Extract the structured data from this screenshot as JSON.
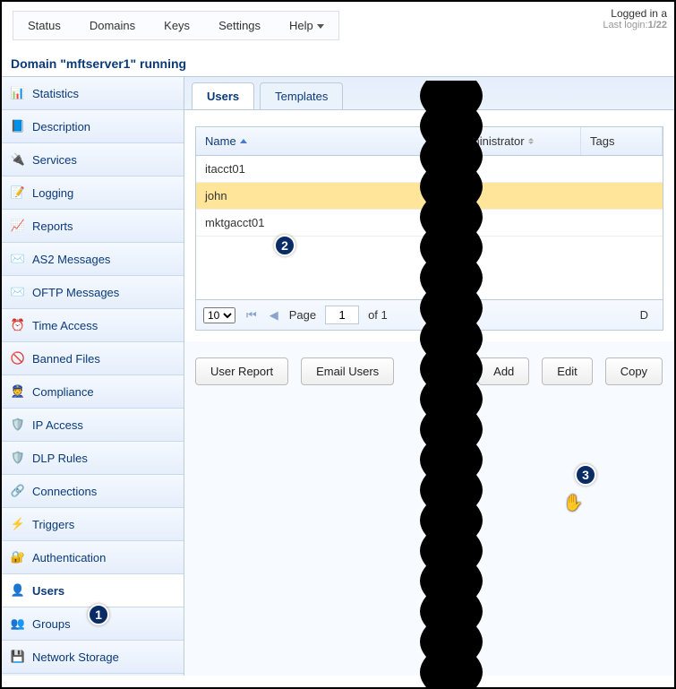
{
  "topnav": {
    "items": [
      "Status",
      "Domains",
      "Keys",
      "Settings",
      "Help"
    ]
  },
  "login": {
    "line1": "Logged in a",
    "line2_label": "Last login:",
    "line2_value": "1/22"
  },
  "domain_title": "Domain \"mftserver1\" running",
  "sidebar": {
    "items": [
      {
        "label": "Statistics",
        "icon": "📊"
      },
      {
        "label": "Description",
        "icon": "📘"
      },
      {
        "label": "Services",
        "icon": "🔌"
      },
      {
        "label": "Logging",
        "icon": "📝"
      },
      {
        "label": "Reports",
        "icon": "📈"
      },
      {
        "label": "AS2 Messages",
        "icon": "✉️"
      },
      {
        "label": "OFTP Messages",
        "icon": "✉️"
      },
      {
        "label": "Time Access",
        "icon": "⏰"
      },
      {
        "label": "Banned Files",
        "icon": "🚫"
      },
      {
        "label": "Compliance",
        "icon": "👮"
      },
      {
        "label": "IP Access",
        "icon": "🛡️"
      },
      {
        "label": "DLP Rules",
        "icon": "🛡️"
      },
      {
        "label": "Connections",
        "icon": "🔗"
      },
      {
        "label": "Triggers",
        "icon": "⚡"
      },
      {
        "label": "Authentication",
        "icon": "🔐"
      },
      {
        "label": "Users",
        "icon": "👤",
        "active": true
      },
      {
        "label": "Groups",
        "icon": "👥"
      },
      {
        "label": "Network Storage",
        "icon": "💾"
      }
    ]
  },
  "tabs": [
    {
      "label": "Users",
      "active": true
    },
    {
      "label": "Templates"
    }
  ],
  "grid": {
    "columns": [
      {
        "label": "Name",
        "sorted": "asc"
      },
      {
        "label": "Administrator"
      },
      {
        "label": "Tags"
      }
    ],
    "rows": [
      {
        "name": "itacct01"
      },
      {
        "name": "john",
        "selected": true
      },
      {
        "name": "mktgacct01"
      }
    ]
  },
  "pager": {
    "page_size": "10",
    "page_label": "Page",
    "page": "1",
    "of_label": "of 1",
    "display": "D"
  },
  "actions": {
    "user_report": "User Report",
    "email_users": "Email Users",
    "add": "Add",
    "edit": "Edit",
    "copy": "Copy"
  },
  "annotations": {
    "a1": "1",
    "a2": "2",
    "a3": "3"
  }
}
